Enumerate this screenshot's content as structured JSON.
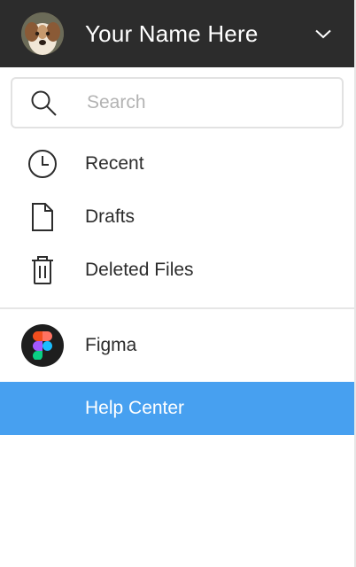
{
  "header": {
    "user_name": "Your Name Here",
    "avatar_icon": "avatar",
    "menu_icon": "chevron-down-icon"
  },
  "search": {
    "placeholder": "Search",
    "value": "",
    "icon": "search-icon"
  },
  "nav": {
    "items": [
      {
        "label": "Recent",
        "icon": "clock-icon"
      },
      {
        "label": "Drafts",
        "icon": "file-icon"
      },
      {
        "label": "Deleted Files",
        "icon": "trash-icon"
      }
    ]
  },
  "org": {
    "label": "Figma",
    "icon": "figma-logo-icon"
  },
  "help": {
    "label": "Help Center",
    "selected": true
  },
  "colors": {
    "header_bg": "#2c2c2c",
    "selected_bg": "#47a0f0",
    "text": "#2c2c2c",
    "placeholder": "#b3b3b3",
    "divider": "#e6e6e6"
  }
}
